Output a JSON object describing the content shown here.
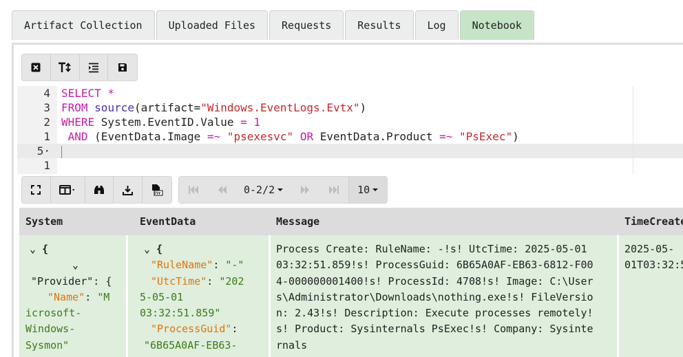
{
  "tabs": [
    {
      "label": "Artifact Collection",
      "active": false
    },
    {
      "label": "Uploaded Files",
      "active": false
    },
    {
      "label": "Requests",
      "active": false
    },
    {
      "label": "Results",
      "active": false
    },
    {
      "label": "Log",
      "active": false
    },
    {
      "label": "Notebook",
      "active": true
    }
  ],
  "editor_toolbar": {
    "icons": [
      "close-icon",
      "text-size-icon",
      "indent-icon",
      "save-icon"
    ]
  },
  "editor": {
    "lines": [
      {
        "num": "4",
        "segments": [
          {
            "t": "SELECT *",
            "c": "kw"
          }
        ]
      },
      {
        "num": "3",
        "segments": [
          {
            "t": "FROM ",
            "c": "kw"
          },
          {
            "t": "source",
            "c": "fn"
          },
          {
            "t": "(artifact=",
            "c": ""
          },
          {
            "t": "\"Windows.EventLogs.Evtx\"",
            "c": "str"
          },
          {
            "t": ")",
            "c": ""
          }
        ]
      },
      {
        "num": "2",
        "segments": [
          {
            "t": "WHERE ",
            "c": "kw"
          },
          {
            "t": "System.EventID.Value ",
            "c": ""
          },
          {
            "t": "= 1",
            "c": "kw"
          }
        ]
      },
      {
        "num": "1",
        "segments": [
          {
            "t": " AND ",
            "c": "kw"
          },
          {
            "t": "(EventData.Image ",
            "c": ""
          },
          {
            "t": "=~ ",
            "c": "kw"
          },
          {
            "t": "\"psexesvc\" ",
            "c": "str"
          },
          {
            "t": "OR ",
            "c": "kw"
          },
          {
            "t": "EventData.Product ",
            "c": ""
          },
          {
            "t": "=~ ",
            "c": "kw"
          },
          {
            "t": "\"PsExec\"",
            "c": "str"
          },
          {
            "t": ")",
            "c": ""
          }
        ]
      },
      {
        "num": "5·",
        "segments": [],
        "active": true
      },
      {
        "num": "1",
        "segments": []
      }
    ]
  },
  "results_toolbar": {
    "icons": [
      "fullscreen-icon",
      "columns-icon",
      "binoculars-icon",
      "download-icon",
      "csv-icon"
    ]
  },
  "pager": {
    "range": "0-2/2",
    "page_size": "10",
    "icons": [
      "first-page-icon",
      "prev-page-icon",
      "next-page-icon",
      "last-page-icon"
    ]
  },
  "table": {
    "columns": [
      "System",
      "EventData",
      "Message",
      "TimeCreate"
    ],
    "row": {
      "system_lines": [
        "⌄ {",
        "⌄",
        "\"Provider\": {",
        "\"Name\": \"M",
        "icrosoft-",
        "Windows-",
        "Sysmon\""
      ],
      "eventdata_lines": [
        "⌄ {",
        "\"RuleName\": \"-\"",
        "\"UtcTime\": \"202",
        "5-05-01",
        "03:32:51.859\"",
        "\"ProcessGuid\":",
        "\"6B65A0AF-EB63-"
      ],
      "message": "Process Create: RuleName: -!s! UtcTime: 2025-05-01 03:32:51.859!s! ProcessGuid: 6B65A0AF-EB63-6812-F004-000000001400!s! ProcessId: 4708!s! Image: C:\\Users\\Administrator\\Downloads\\nothing.exe!s! FileVersion: 2.43!s! Description: Execute processes remotely!s! Product: Sysinternals PsExec!s! Company: Sysinternals",
      "time_lines": [
        "2025-05-",
        "01T03:32:5"
      ]
    }
  }
}
